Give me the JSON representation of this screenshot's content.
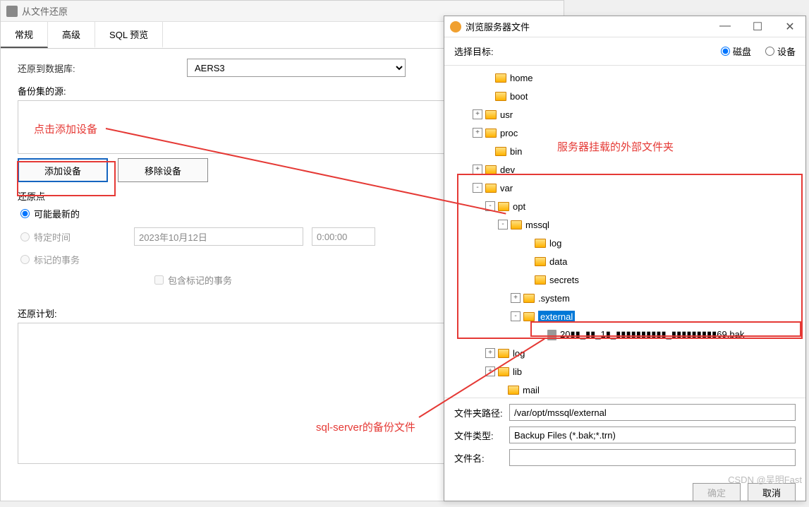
{
  "mainWindow": {
    "title": "从文件还原",
    "tabs": [
      "常规",
      "高级",
      "SQL 预览"
    ],
    "restoreToLabel": "还原到数据库:",
    "restoreToValue": "AERS3",
    "backupSourceLabel": "备份集的源:",
    "addDeviceBtn": "添加设备",
    "removeDeviceBtn": "移除设备",
    "restorePointLabel": "还原点",
    "radioLatest": "可能最新的",
    "radioSpecific": "特定时间",
    "radioMarked": "标记的事务",
    "dateValue": "2023年10月12日",
    "timeValue": "0:00:00",
    "includeMarked": "包含标记的事务",
    "restorePlanLabel": "还原计划:"
  },
  "browser": {
    "title": "浏览服务器文件",
    "selectTargetLabel": "选择目标:",
    "diskOpt": "磁盘",
    "deviceOpt": "设备",
    "tree": [
      {
        "indent": 44,
        "toggle": "",
        "label": "home"
      },
      {
        "indent": 44,
        "toggle": "",
        "label": "boot"
      },
      {
        "indent": 30,
        "toggle": "+",
        "label": "usr"
      },
      {
        "indent": 30,
        "toggle": "+",
        "label": "proc"
      },
      {
        "indent": 44,
        "toggle": "",
        "label": "bin"
      },
      {
        "indent": 30,
        "toggle": "+",
        "label": "dev"
      },
      {
        "indent": 30,
        "toggle": "-",
        "label": "var"
      },
      {
        "indent": 48,
        "toggle": "-",
        "label": "opt"
      },
      {
        "indent": 66,
        "toggle": "-",
        "label": "mssql"
      },
      {
        "indent": 100,
        "toggle": "",
        "label": "log"
      },
      {
        "indent": 100,
        "toggle": "",
        "label": "data"
      },
      {
        "indent": 100,
        "toggle": "",
        "label": "secrets"
      },
      {
        "indent": 84,
        "toggle": "+",
        "label": ".system"
      },
      {
        "indent": 84,
        "toggle": "-",
        "label": "external",
        "selected": true
      },
      {
        "indent": 118,
        "toggle": "",
        "label": "20▮▮_▮▮_1▮_▮▮▮▮▮▮▮▮▮▮_▮▮▮▮▮▮▮▮▮69.bak",
        "file": true
      },
      {
        "indent": 48,
        "toggle": "+",
        "label": "log"
      },
      {
        "indent": 48,
        "toggle": "+",
        "label": "lib"
      },
      {
        "indent": 62,
        "toggle": "",
        "label": "mail"
      }
    ],
    "pathLabel": "文件夹路径:",
    "pathValue": "/var/opt/mssql/external",
    "typeLabel": "文件类型:",
    "typeValue": "Backup Files (*.bak;*.trn)",
    "nameLabel": "文件名:",
    "nameValue": "",
    "okBtn": "确定",
    "cancelBtn": "取消"
  },
  "annotations": {
    "clickAdd": "点击添加设备",
    "mounted": "服务器挂载的外部文件夹",
    "backupFile": "sql-server的备份文件"
  },
  "watermark": "CSDN @吴明Fast"
}
